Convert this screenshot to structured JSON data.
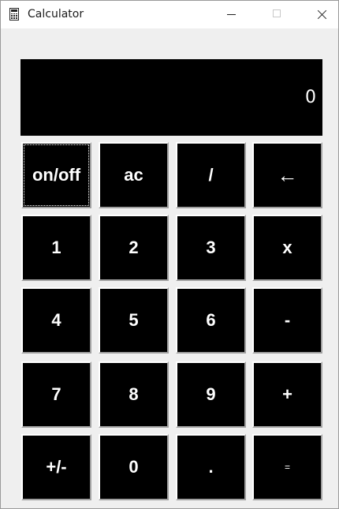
{
  "window": {
    "title": "Calculator",
    "app_icon": "calculator-icon",
    "controls": [
      "minimize-icon",
      "maximize-icon",
      "close-icon"
    ]
  },
  "display": {
    "value": "0"
  },
  "keypad": {
    "rows": [
      [
        "on/off",
        "ac",
        "/",
        "←"
      ],
      [
        "1",
        "2",
        "3",
        "x"
      ],
      [
        "4",
        "5",
        "6",
        "-"
      ],
      [
        "7",
        "8",
        "9",
        "+"
      ],
      [
        "+/-",
        "0",
        ".",
        "="
      ]
    ]
  },
  "colors": {
    "display_bg": "#000000",
    "key_bg": "#000000",
    "key_text": "#ffffff",
    "window_bg": "#efefef"
  }
}
